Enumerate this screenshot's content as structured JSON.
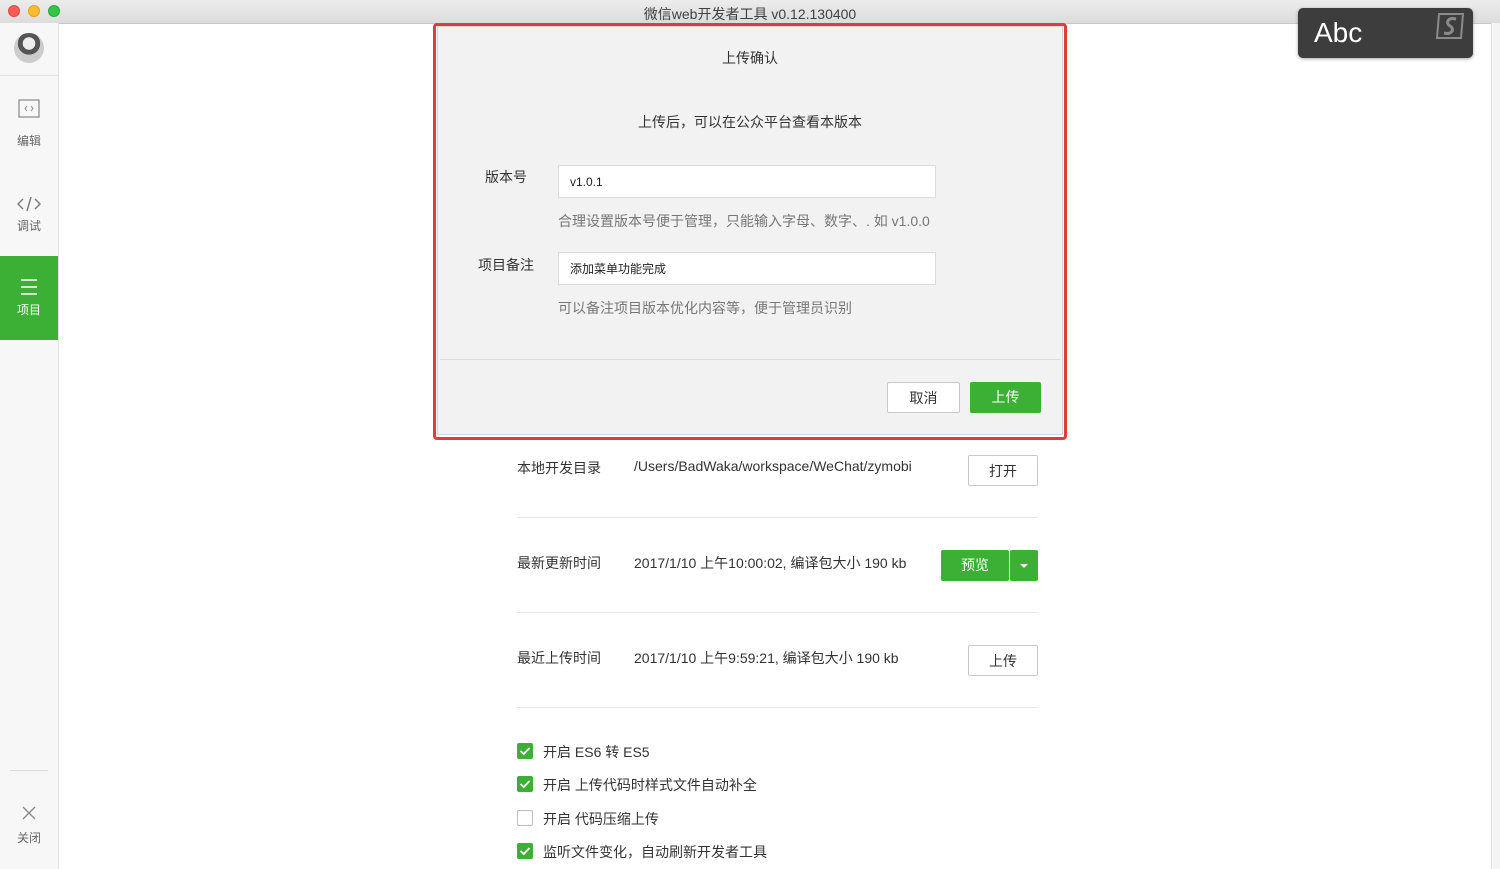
{
  "window": {
    "title": "微信web开发者工具 v0.12.130400"
  },
  "sidebar": {
    "items": [
      {
        "label": "编辑",
        "icon": "code-file-icon"
      },
      {
        "label": "调试",
        "icon": "code-brackets-icon"
      },
      {
        "label": "项目",
        "icon": "menu-lines-icon",
        "active": true
      }
    ],
    "close_label": "关闭"
  },
  "dialog": {
    "title": "上传确认",
    "subtitle": "上传后，可以在公众平台查看本版本",
    "version_label": "版本号",
    "version_value": "v1.0.1",
    "version_hint": "合理设置版本号便于管理，只能输入字母、数字、. 如 v1.0.0",
    "note_label": "项目备注",
    "note_value": "添加菜单功能完成",
    "note_hint": "可以备注项目版本优化内容等，便于管理员识别",
    "cancel_label": "取消",
    "upload_label": "上传"
  },
  "project": {
    "local_dir_label": "本地开发目录",
    "local_dir_value": "/Users/BadWaka/workspace/WeChat/zymobi",
    "open_label": "打开",
    "last_update_label": "最新更新时间",
    "last_update_value": "2017/1/10 上午10:00:02, 编译包大小 190 kb",
    "preview_label": "预览",
    "last_upload_label": "最近上传时间",
    "last_upload_value": "2017/1/10 上午9:59:21, 编译包大小 190 kb",
    "upload_label": "上传"
  },
  "options": [
    {
      "label": "开启 ES6 转 ES5",
      "checked": true
    },
    {
      "label": "开启 上传代码时样式文件自动补全",
      "checked": true
    },
    {
      "label": "开启 代码压缩上传",
      "checked": false
    },
    {
      "label": "监听文件变化，自动刷新开发者工具",
      "checked": true
    }
  ],
  "input_overlay": {
    "text": "Abc"
  },
  "colors": {
    "accent": "#3cb034",
    "highlight": "#e33b3b"
  }
}
